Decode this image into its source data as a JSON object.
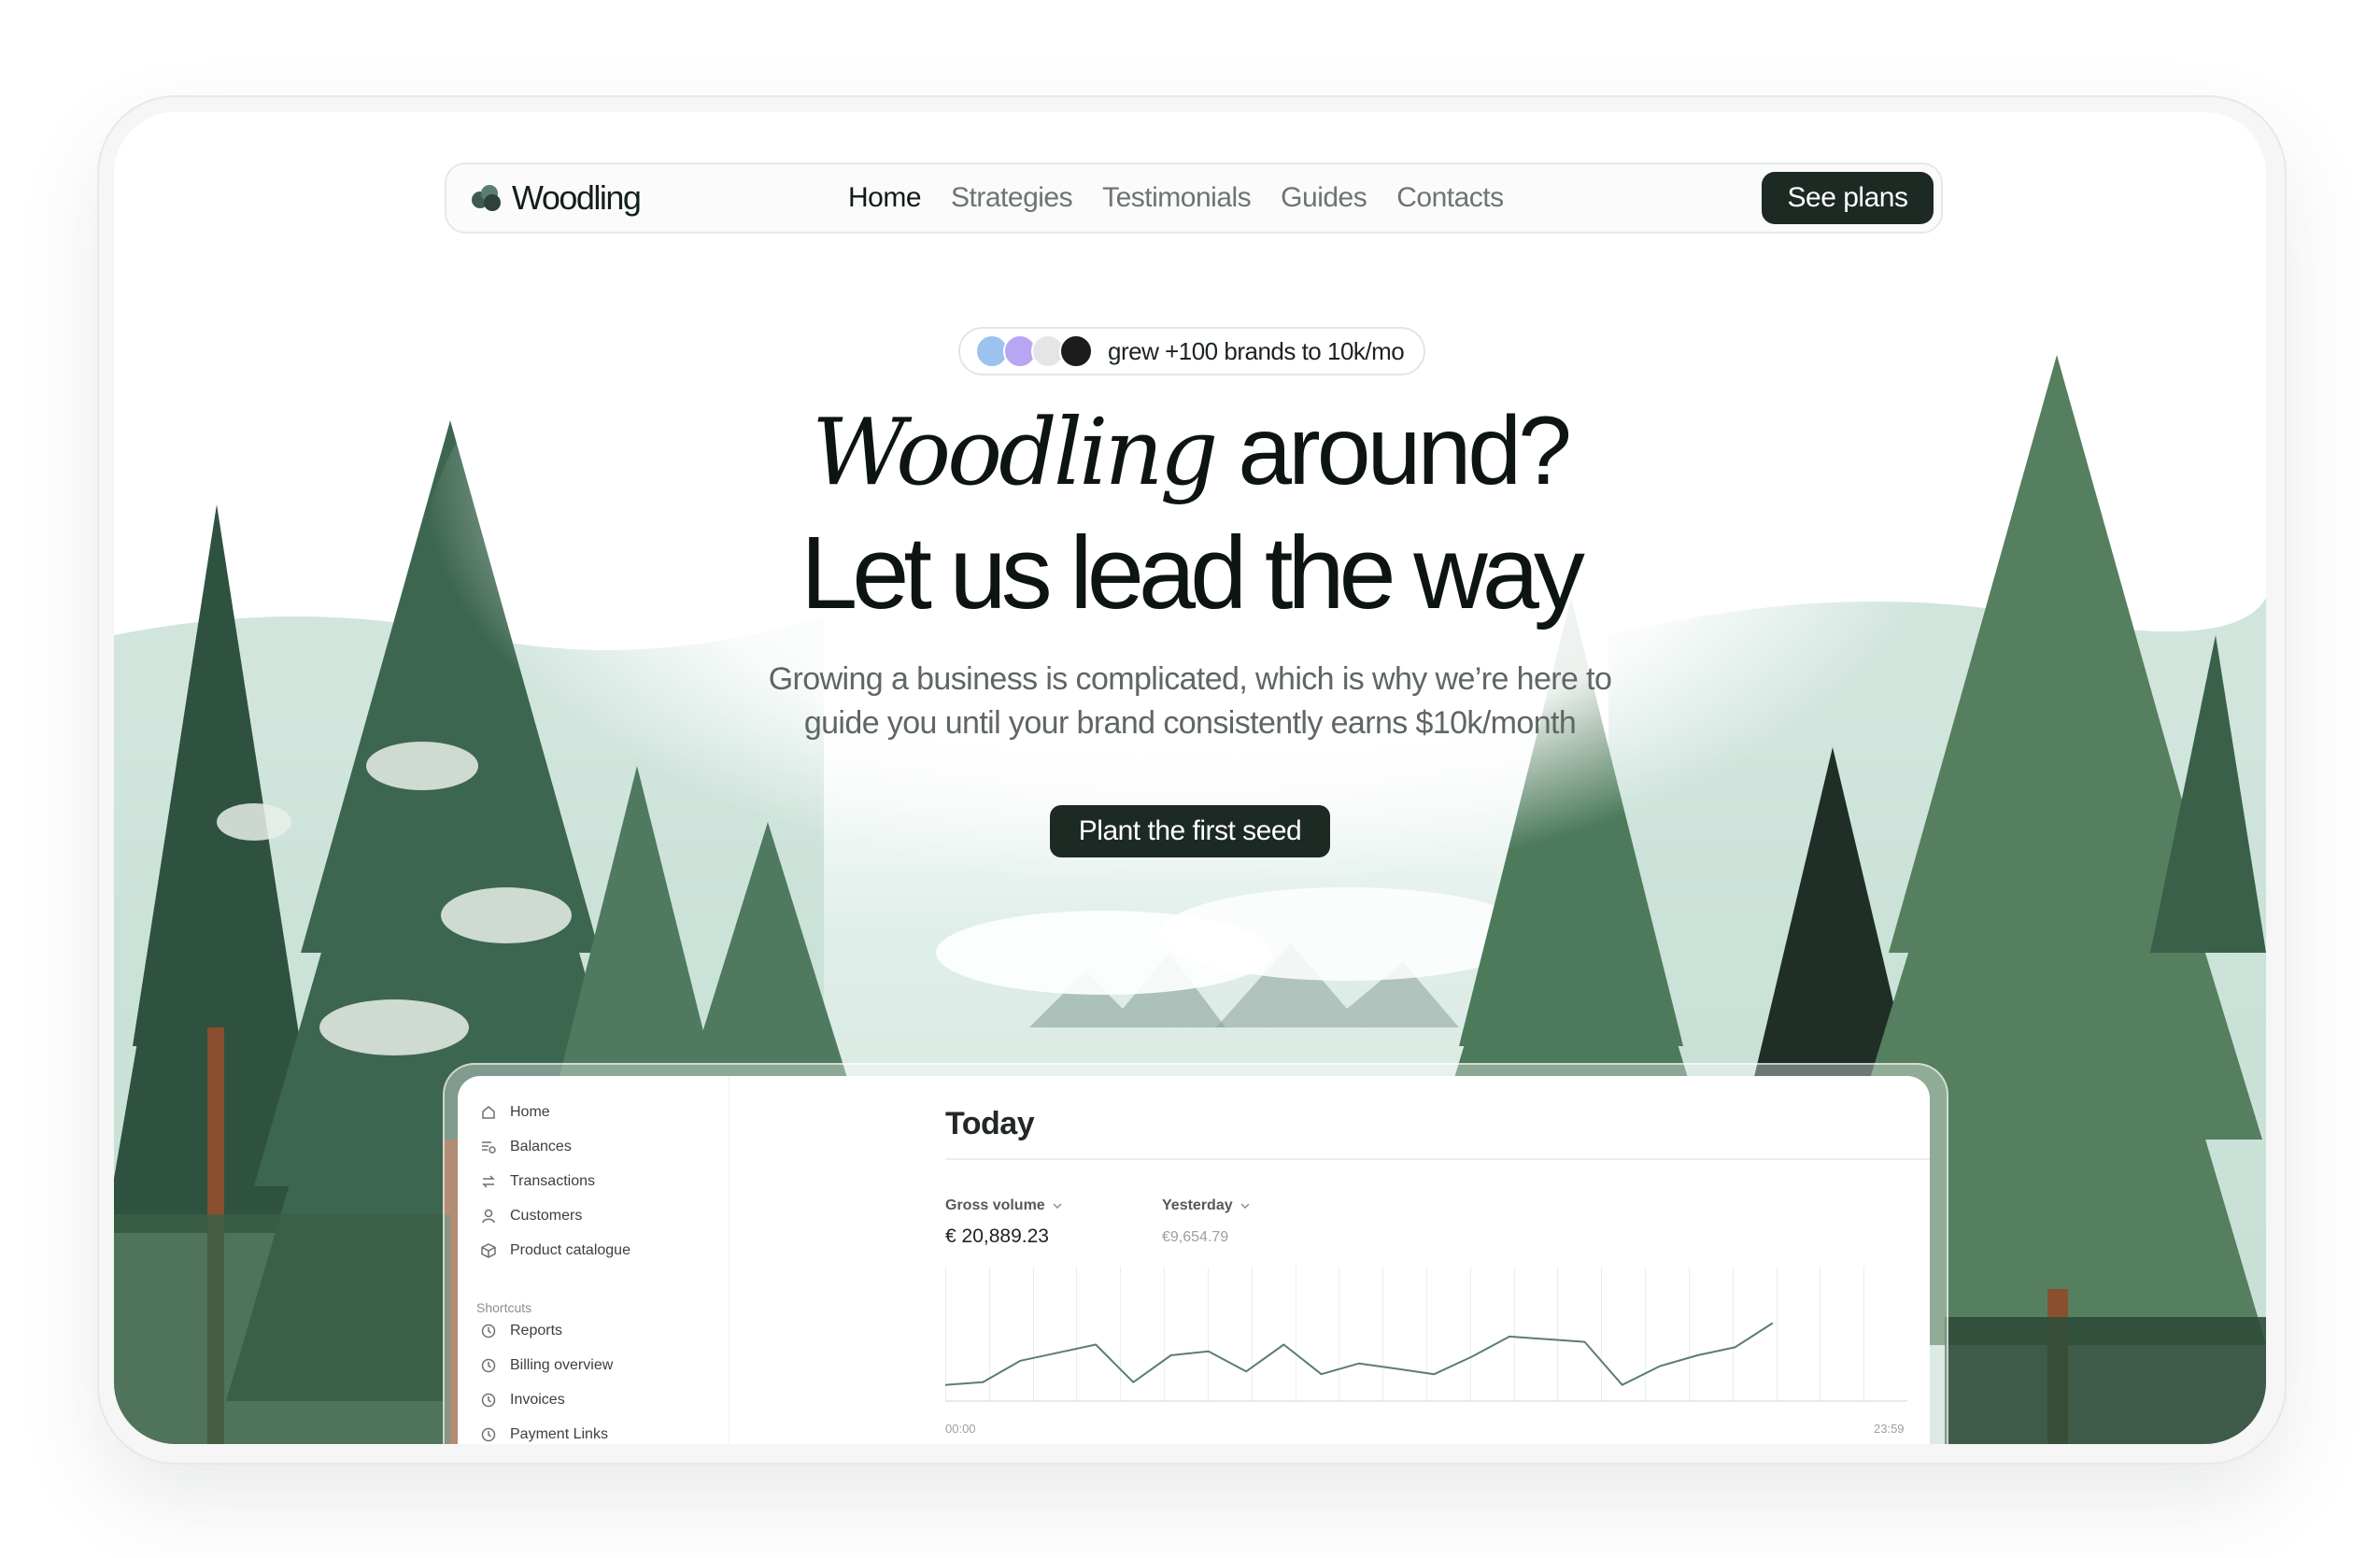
{
  "nav": {
    "brand": "Woodling",
    "links": [
      "Home",
      "Strategies",
      "Testimonials",
      "Guides",
      "Contacts"
    ],
    "active": "Home",
    "cta": "See plans"
  },
  "hero": {
    "badge": "grew +100 brands to 10k/mo",
    "headline_italic": "Woodling",
    "headline_rest": "around?",
    "headline_line2": "Let us lead the way",
    "subtitle_line1": "Growing a business is complicated, which is why we’re here to",
    "subtitle_line2": "guide you until your brand consistently earns $10k/month",
    "cta": "Plant the first seed"
  },
  "dashboard": {
    "sidebar": {
      "items": [
        {
          "label": "Home",
          "icon": "home-icon"
        },
        {
          "label": "Balances",
          "icon": "balances-icon"
        },
        {
          "label": "Transactions",
          "icon": "transfer-icon"
        },
        {
          "label": "Customers",
          "icon": "user-icon"
        },
        {
          "label": "Product catalogue",
          "icon": "box-icon"
        }
      ],
      "shortcuts_heading": "Shortcuts",
      "shortcuts": [
        {
          "label": "Reports",
          "icon": "clock-icon"
        },
        {
          "label": "Billing overview",
          "icon": "clock-icon"
        },
        {
          "label": "Invoices",
          "icon": "clock-icon"
        },
        {
          "label": "Payment Links",
          "icon": "clock-icon"
        }
      ]
    },
    "title": "Today",
    "metric_primary_label": "Gross volume",
    "metric_primary_value": "€ 20,889.23",
    "metric_compare_label": "Yesterday",
    "metric_compare_value": "€9,654.79",
    "axis_start": "00:00",
    "axis_end": "23:59",
    "line_color": "#5b7d72",
    "series": [
      12,
      14,
      30,
      36,
      42,
      14,
      34,
      37,
      22,
      42,
      20,
      28,
      24,
      20,
      33,
      48,
      46,
      44,
      12,
      26,
      34,
      40,
      58
    ],
    "series_max": 100
  },
  "colors": {
    "dark": "#1d2a24",
    "accent": "#5b7d72"
  }
}
